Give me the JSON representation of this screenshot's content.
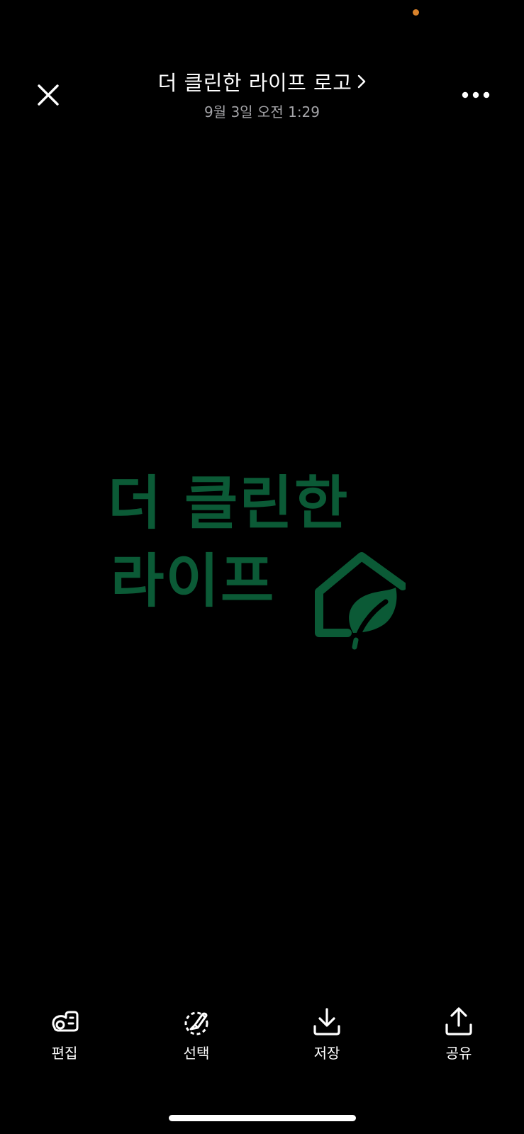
{
  "status_bar": {
    "indicator_color": "#d9822b"
  },
  "header": {
    "close_icon": "close-icon",
    "title": "더 클린한 라이프 로고",
    "title_chevron_icon": "chevron-right-icon",
    "subtitle": "9월 3일 오전 1:29",
    "more_icon": "ellipsis-icon"
  },
  "photo": {
    "logo_line1": "더 클린한",
    "logo_line2": "라이프",
    "logo_color": "#0b5a36",
    "logo_icon": "house-leaf-icon"
  },
  "toolbar": {
    "items": [
      {
        "label": "편집",
        "icon": "edit-icon"
      },
      {
        "label": "선택",
        "icon": "select-icon"
      },
      {
        "label": "저장",
        "icon": "download-icon"
      },
      {
        "label": "공유",
        "icon": "share-icon"
      }
    ]
  }
}
